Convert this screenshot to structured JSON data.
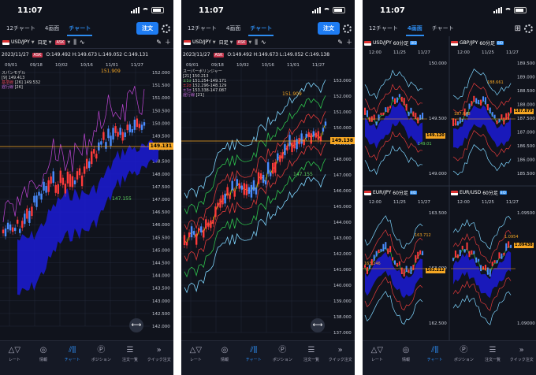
{
  "status_time": "11:07",
  "screen1": {
    "tabs": [
      "12チャート",
      "4画面",
      "チャート"
    ],
    "order": "注文",
    "symbol": "USD/JPY",
    "timeframe": "日足",
    "ask": "ASK",
    "info_date": "2023/11/27",
    "info_ohlc": "O:149.492 H:149.673 L:149.052 C:149.131",
    "indicator_title": "スパンモデル",
    "legend": [
      "[9] 149.413",
      "[26] 149.532",
      "[26]"
    ],
    "legend_names": [
      "基準線",
      "遅行線"
    ],
    "dates": [
      "09/01",
      "09/18",
      "10/02",
      "10/16",
      "11/01",
      "11/27"
    ],
    "prices": [
      "152.000",
      "151.500",
      "151.000",
      "150.500",
      "150.000",
      "149.500",
      "149.000",
      "148.500",
      "148.000",
      "147.500",
      "147.000",
      "146.500",
      "146.000",
      "145.500",
      "145.000",
      "144.500",
      "144.000",
      "143.500",
      "143.000",
      "142.500",
      "142.000"
    ],
    "current": "149.131",
    "high": "151.909",
    "low": "147.155"
  },
  "screen2": {
    "tabs": [
      "12チャート",
      "4画面",
      "チャート"
    ],
    "order": "注文",
    "symbol": "USD/JPY",
    "timeframe": "日足",
    "info_date": "2023/11/27",
    "info_ohlc": "O:149.492 H:149.673 L:149.052 C:149.138",
    "indicator_title": "スーパーボリンジャー",
    "legend": [
      "[21] 150.213",
      "151.254-149.171",
      "152.296-148.129",
      "153.338-147.087",
      "[21]"
    ],
    "legend_marks": [
      "±1σ",
      "±2σ",
      "±3σ",
      "遅行線"
    ],
    "dates": [
      "09/01",
      "09/18",
      "10/02",
      "10/16",
      "11/01",
      "11/27"
    ],
    "prices": [
      "153.000",
      "152.000",
      "151.000",
      "150.000",
      "149.000",
      "148.000",
      "147.000",
      "146.000",
      "145.000",
      "144.000",
      "143.000",
      "142.000",
      "141.000",
      "140.000",
      "139.000",
      "138.000",
      "137.000"
    ],
    "current": "149.138",
    "high": "151.909",
    "low": "147.155"
  },
  "screen3": {
    "tabs": [
      "12チャート",
      "4画面",
      "チャート"
    ],
    "panels": [
      {
        "title": "USD/JPY",
        "tf": "60分足",
        "times": [
          "12:00",
          "11/25",
          "11/27"
        ],
        "prices": [
          "150.000",
          "149.500",
          "149.000"
        ],
        "tag": "149.120",
        "low": "149.01"
      },
      {
        "title": "GBP/JPY",
        "tf": "60分足",
        "times": [
          "12:00",
          "11/25",
          "11/27"
        ],
        "prices": [
          "189.500",
          "189.000",
          "188.500",
          "188.000",
          "187.500",
          "187.000",
          "186.500",
          "186.000",
          "185.500"
        ],
        "tag": "187.879",
        "hi": "188.661",
        "mid": "187.648"
      },
      {
        "title": "EUR/JPY",
        "tf": "60分足",
        "times": [
          "12:00",
          "11/25",
          "11/27"
        ],
        "prices": [
          "163.500",
          "163.000",
          "162.500"
        ],
        "tag": "163.212",
        "hi": "163.712",
        "mid": "163.246"
      },
      {
        "title": "EUR/USD",
        "tf": "60分足",
        "times": [
          "12:00",
          "11/25",
          "11/27"
        ],
        "prices": [
          "1.09500",
          "1.09000"
        ],
        "tag": "1.09438",
        "hi": "1.0954"
      }
    ]
  },
  "nav": [
    "レート",
    "情報",
    "チャート",
    "ポジション",
    "注文一覧",
    "クイック注文"
  ]
}
